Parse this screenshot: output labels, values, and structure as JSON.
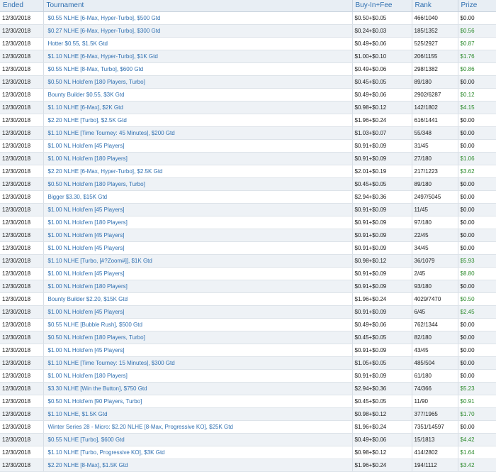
{
  "table": {
    "headers": {
      "ended": "Ended",
      "tournament": "Tournament",
      "buyin": "Buy-In+Fee",
      "rank": "Rank",
      "prize": "Prize"
    },
    "win_color": "#2e8b2e",
    "link_color": "#2f6fb0",
    "rows": [
      {
        "ended": "12/30/2018",
        "tournament": "$0.55 NLHE [6-Max, Hyper-Turbo], $500 Gtd",
        "buyin": "$0.50+$0.05",
        "rank": "466/1040",
        "prize": "$0.00",
        "won": false
      },
      {
        "ended": "12/30/2018",
        "tournament": "$0.27 NLHE [6-Max, Hyper-Turbo], $300 Gtd",
        "buyin": "$0.24+$0.03",
        "rank": "185/1352",
        "prize": "$0.56",
        "won": true
      },
      {
        "ended": "12/30/2018",
        "tournament": "Hotter $0.55, $1.5K Gtd",
        "buyin": "$0.49+$0.06",
        "rank": "525/2927",
        "prize": "$0.87",
        "won": true
      },
      {
        "ended": "12/30/2018",
        "tournament": "$1.10 NLHE [6-Max, Hyper-Turbo], $1K Gtd",
        "buyin": "$1.00+$0.10",
        "rank": "206/1155",
        "prize": "$1.76",
        "won": true
      },
      {
        "ended": "12/30/2018",
        "tournament": "$0.55 NLHE [8-Max, Turbo], $600 Gtd",
        "buyin": "$0.49+$0.06",
        "rank": "298/1382",
        "prize": "$0.86",
        "won": true
      },
      {
        "ended": "12/30/2018",
        "tournament": "$0.50 NL Hold'em [180 Players, Turbo]",
        "buyin": "$0.45+$0.05",
        "rank": "89/180",
        "prize": "$0.00",
        "won": false
      },
      {
        "ended": "12/30/2018",
        "tournament": "Bounty Builder $0.55, $3K Gtd",
        "buyin": "$0.49+$0.06",
        "rank": "2902/6287",
        "prize": "$0.12",
        "won": true
      },
      {
        "ended": "12/30/2018",
        "tournament": "$1.10 NLHE [6-Max], $2K Gtd",
        "buyin": "$0.98+$0.12",
        "rank": "142/1802",
        "prize": "$4.15",
        "won": true
      },
      {
        "ended": "12/30/2018",
        "tournament": "$2.20 NLHE [Turbo], $2.5K Gtd",
        "buyin": "$1.96+$0.24",
        "rank": "616/1441",
        "prize": "$0.00",
        "won": false
      },
      {
        "ended": "12/30/2018",
        "tournament": "$1.10 NLHE [Time Tourney: 45 Minutes], $200 Gtd",
        "buyin": "$1.03+$0.07",
        "rank": "55/348",
        "prize": "$0.00",
        "won": false
      },
      {
        "ended": "12/30/2018",
        "tournament": "$1.00 NL Hold'em [45 Players]",
        "buyin": "$0.91+$0.09",
        "rank": "31/45",
        "prize": "$0.00",
        "won": false
      },
      {
        "ended": "12/30/2018",
        "tournament": "$1.00 NL Hold'em [180 Players]",
        "buyin": "$0.91+$0.09",
        "rank": "27/180",
        "prize": "$1.06",
        "won": true
      },
      {
        "ended": "12/30/2018",
        "tournament": "$2.20 NLHE [6-Max, Hyper-Turbo], $2.5K Gtd",
        "buyin": "$2.01+$0.19",
        "rank": "217/1223",
        "prize": "$3.62",
        "won": true
      },
      {
        "ended": "12/30/2018",
        "tournament": "$0.50 NL Hold'em [180 Players, Turbo]",
        "buyin": "$0.45+$0.05",
        "rank": "89/180",
        "prize": "$0.00",
        "won": false
      },
      {
        "ended": "12/30/2018",
        "tournament": "Bigger $3.30, $15K Gtd",
        "buyin": "$2.94+$0.36",
        "rank": "2497/5045",
        "prize": "$0.00",
        "won": false
      },
      {
        "ended": "12/30/2018",
        "tournament": "$1.00 NL Hold'em [45 Players]",
        "buyin": "$0.91+$0.09",
        "rank": "11/45",
        "prize": "$0.00",
        "won": false
      },
      {
        "ended": "12/30/2018",
        "tournament": "$1.00 NL Hold'em [180 Players]",
        "buyin": "$0.91+$0.09",
        "rank": "97/180",
        "prize": "$0.00",
        "won": false
      },
      {
        "ended": "12/30/2018",
        "tournament": "$1.00 NL Hold'em [45 Players]",
        "buyin": "$0.91+$0.09",
        "rank": "22/45",
        "prize": "$0.00",
        "won": false
      },
      {
        "ended": "12/30/2018",
        "tournament": "$1.00 NL Hold'em [45 Players]",
        "buyin": "$0.91+$0.09",
        "rank": "34/45",
        "prize": "$0.00",
        "won": false
      },
      {
        "ended": "12/30/2018",
        "tournament": "$1.10 NLHE [Turbo, [#?Zoom#]], $1K Gtd",
        "buyin": "$0.98+$0.12",
        "rank": "36/1079",
        "prize": "$5.93",
        "won": true
      },
      {
        "ended": "12/30/2018",
        "tournament": "$1.00 NL Hold'em [45 Players]",
        "buyin": "$0.91+$0.09",
        "rank": "2/45",
        "prize": "$8.80",
        "won": true
      },
      {
        "ended": "12/30/2018",
        "tournament": "$1.00 NL Hold'em [180 Players]",
        "buyin": "$0.91+$0.09",
        "rank": "93/180",
        "prize": "$0.00",
        "won": false
      },
      {
        "ended": "12/30/2018",
        "tournament": "Bounty Builder $2.20, $15K Gtd",
        "buyin": "$1.96+$0.24",
        "rank": "4029/7470",
        "prize": "$0.50",
        "won": true
      },
      {
        "ended": "12/30/2018",
        "tournament": "$1.00 NL Hold'em [45 Players]",
        "buyin": "$0.91+$0.09",
        "rank": "6/45",
        "prize": "$2.45",
        "won": true
      },
      {
        "ended": "12/30/2018",
        "tournament": "$0.55 NLHE [Bubble Rush], $500 Gtd",
        "buyin": "$0.49+$0.06",
        "rank": "762/1344",
        "prize": "$0.00",
        "won": false
      },
      {
        "ended": "12/30/2018",
        "tournament": "$0.50 NL Hold'em [180 Players, Turbo]",
        "buyin": "$0.45+$0.05",
        "rank": "82/180",
        "prize": "$0.00",
        "won": false
      },
      {
        "ended": "12/30/2018",
        "tournament": "$1.00 NL Hold'em [45 Players]",
        "buyin": "$0.91+$0.09",
        "rank": "43/45",
        "prize": "$0.00",
        "won": false
      },
      {
        "ended": "12/30/2018",
        "tournament": "$1.10 NLHE [Time Tourney: 15 Minutes], $300 Gtd",
        "buyin": "$1.05+$0.05",
        "rank": "485/504",
        "prize": "$0.00",
        "won": false
      },
      {
        "ended": "12/30/2018",
        "tournament": "$1.00 NL Hold'em [180 Players]",
        "buyin": "$0.91+$0.09",
        "rank": "61/180",
        "prize": "$0.00",
        "won": false
      },
      {
        "ended": "12/30/2018",
        "tournament": "$3.30 NLHE [Win the Button], $750 Gtd",
        "buyin": "$2.94+$0.36",
        "rank": "74/366",
        "prize": "$5.23",
        "won": true
      },
      {
        "ended": "12/30/2018",
        "tournament": "$0.50 NL Hold'em [90 Players, Turbo]",
        "buyin": "$0.45+$0.05",
        "rank": "11/90",
        "prize": "$0.91",
        "won": true
      },
      {
        "ended": "12/30/2018",
        "tournament": "$1.10 NLHE, $1.5K Gtd",
        "buyin": "$0.98+$0.12",
        "rank": "377/1965",
        "prize": "$1.70",
        "won": true
      },
      {
        "ended": "12/30/2018",
        "tournament": "Winter Series 28 - Micro: $2.20 NLHE [8-Max, Progressive KO], $25K Gtd",
        "buyin": "$1.96+$0.24",
        "rank": "7351/14597",
        "prize": "$0.00",
        "won": false
      },
      {
        "ended": "12/30/2018",
        "tournament": "$0.55 NLHE [Turbo], $600 Gtd",
        "buyin": "$0.49+$0.06",
        "rank": "15/1813",
        "prize": "$4.42",
        "won": true
      },
      {
        "ended": "12/30/2018",
        "tournament": "$1.10 NLHE [Turbo, Progressive KO], $3K Gtd",
        "buyin": "$0.98+$0.12",
        "rank": "414/2802",
        "prize": "$1.64",
        "won": true
      },
      {
        "ended": "12/30/2018",
        "tournament": "$2.20 NLHE [8-Max], $1.5K Gtd",
        "buyin": "$1.96+$0.24",
        "rank": "194/1112",
        "prize": "$3.42",
        "won": true
      }
    ]
  }
}
